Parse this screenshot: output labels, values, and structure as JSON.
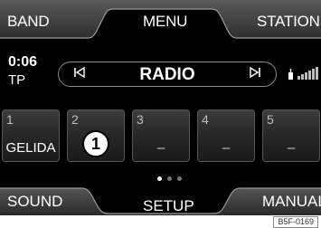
{
  "top_bar": {
    "band_label": "BAND",
    "menu_label": "MENU",
    "stations_label": "STATIONS"
  },
  "status": {
    "time": "0:06",
    "traffic_program": "TP",
    "source_title": "RADIO",
    "prev_icon": "seek-previous-icon",
    "next_icon": "seek-next-icon",
    "antenna_icon": "antenna-icon",
    "signal_icon": "signal-strength-icon"
  },
  "presets": [
    {
      "number": "1",
      "name": "GELIDA"
    },
    {
      "number": "2",
      "name": "–"
    },
    {
      "number": "3",
      "name": "–"
    },
    {
      "number": "4",
      "name": "–"
    },
    {
      "number": "5",
      "name": "–"
    }
  ],
  "page_indicator": {
    "pages": 3,
    "active": 1
  },
  "callout": "1",
  "bottom_bar": {
    "sound_label": "SOUND",
    "setup_label": "SETUP",
    "manual_label": "MANUAL"
  },
  "figure_code": "B5F-0169",
  "colors": {
    "background": "#000000",
    "text": "#ffffff",
    "tab_active": "#4a4a4a",
    "border": "#8a8a8a"
  }
}
